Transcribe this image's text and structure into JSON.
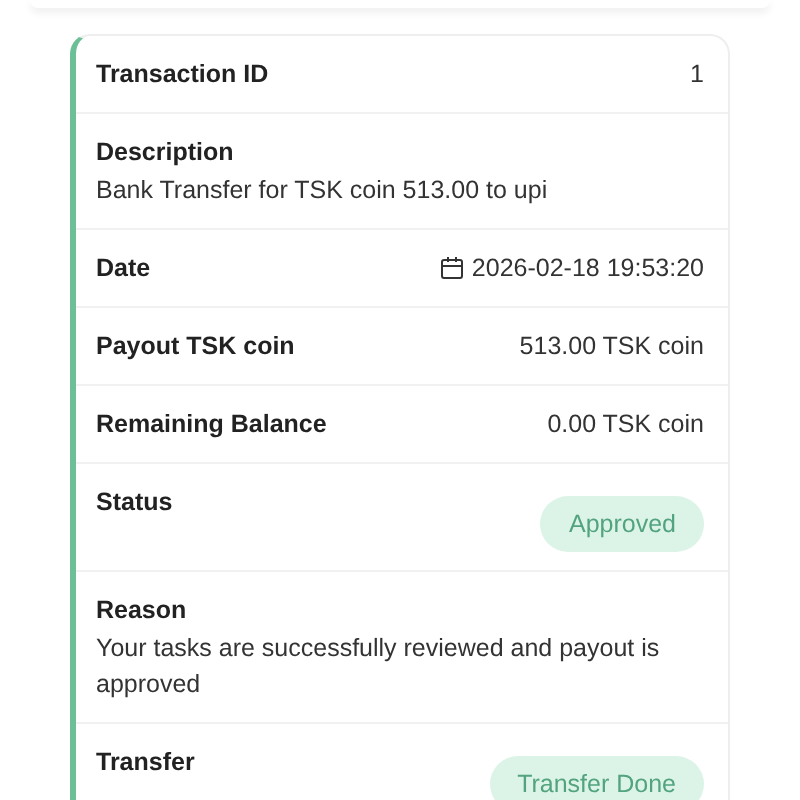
{
  "rows": [
    {
      "kind": "inline",
      "label": "Transaction ID",
      "value": "1"
    },
    {
      "kind": "stacked",
      "label": "Description",
      "value": "Bank Transfer for TSK coin 513.00 to upi"
    },
    {
      "kind": "date",
      "label": "Date",
      "value": "2026-02-18 19:53:20"
    },
    {
      "kind": "inline",
      "label": "Payout TSK coin",
      "value": "513.00 TSK coin"
    },
    {
      "kind": "inline",
      "label": "Remaining Balance",
      "value": "0.00 TSK coin"
    },
    {
      "kind": "badge",
      "label": "Status",
      "value": "Approved"
    },
    {
      "kind": "stacked",
      "label": "Reason",
      "value": "Your tasks are successfully reviewed and payout is approved"
    },
    {
      "kind": "badge",
      "label": "Transfer",
      "value": "Transfer Done"
    }
  ]
}
